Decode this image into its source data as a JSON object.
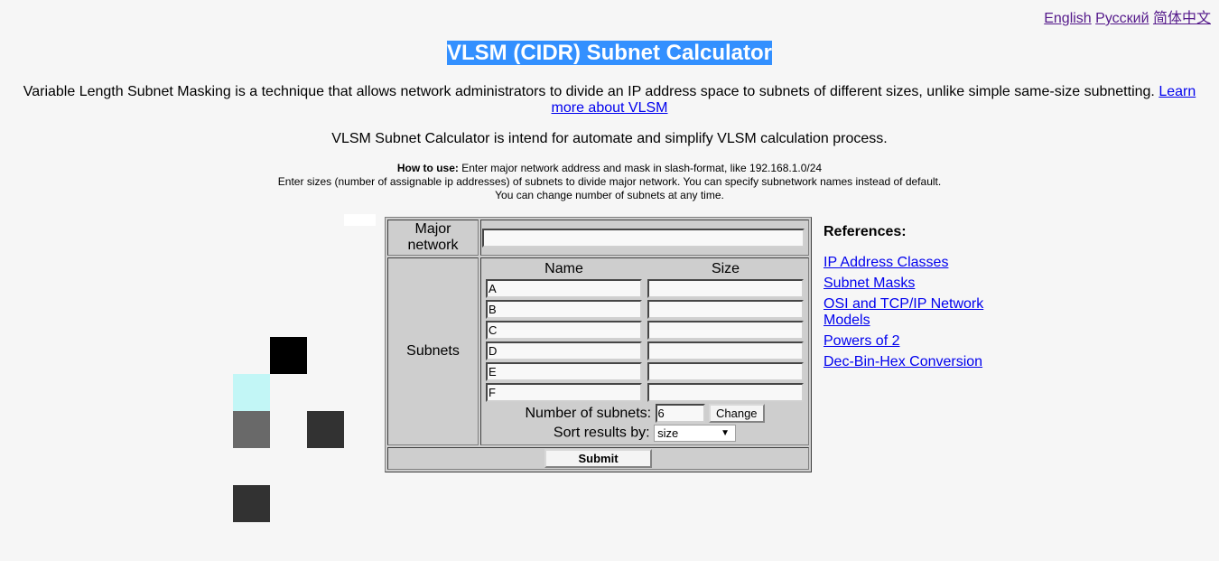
{
  "languages": [
    "English",
    "Русский",
    "简体中文"
  ],
  "title": "VLSM (CIDR) Subnet Calculator",
  "description": "Variable Length Subnet Masking is a technique that allows network administrators to divide an IP address space to subnets of different sizes, unlike simple same-size subnetting.",
  "learn_more_link": "Learn more about VLSM",
  "intro": "VLSM Subnet Calculator is intend for automate and simplify VLSM calculation process.",
  "how_to": {
    "label": "How to use:",
    "line1": "Enter major network address and mask in slash-format, like 192.168.1.0/24",
    "line2": "Enter sizes (number of assignable ip addresses) of subnets to divide major network. You can specify subnetwork names instead of default.",
    "line3": "You can change number of subnets at any time."
  },
  "form": {
    "major_network_label": "Major network",
    "major_network_value": "",
    "subnets_label": "Subnets",
    "name_header": "Name",
    "size_header": "Size",
    "subnets": [
      {
        "name": "A",
        "size": ""
      },
      {
        "name": "B",
        "size": ""
      },
      {
        "name": "C",
        "size": ""
      },
      {
        "name": "D",
        "size": ""
      },
      {
        "name": "E",
        "size": ""
      },
      {
        "name": "F",
        "size": ""
      }
    ],
    "num_subnets_label": "Number of subnets:",
    "num_subnets_value": "6",
    "change_button": "Change",
    "sort_label": "Sort results by:",
    "sort_value": "size",
    "submit_button": "Submit"
  },
  "references": {
    "heading": "References:",
    "links": [
      "IP Address Classes",
      "Subnet Masks",
      "OSI and TCP/IP Network Models",
      "Powers of 2",
      "Dec-Bin-Hex Conversion"
    ]
  },
  "decor_colors": {
    "black": "#000000",
    "cyan": "#c2f6f6",
    "gray": "#696969",
    "dark": "#323232",
    "white": "#ffffff"
  }
}
